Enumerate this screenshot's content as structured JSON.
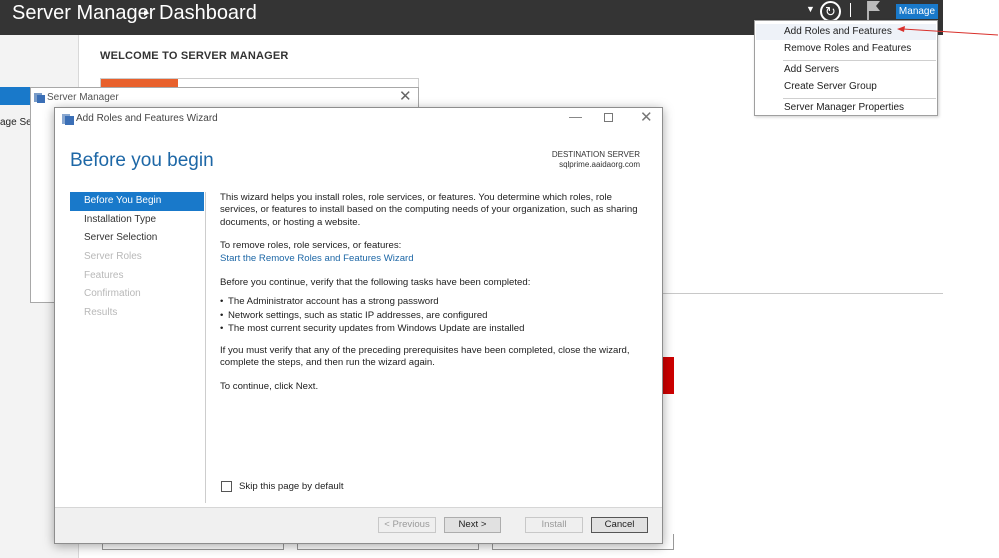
{
  "app": {
    "breadcrumb_root": "Server Manager",
    "breadcrumb_sep": "▸",
    "breadcrumb_page": "Dashboard",
    "manage_label": "Manage",
    "left_truncated_text": "age Se",
    "welcome_heading": "WELCOME TO SERVER MANAGER"
  },
  "behind_window": {
    "title": "Server Manager"
  },
  "wizard": {
    "title": "Add Roles and Features Wizard",
    "heading": "Before you begin",
    "destination_label": "DESTINATION SERVER",
    "destination_value": "sqlprime.aaidaorg.com",
    "nav": [
      {
        "label": "Before You Begin",
        "state": "active"
      },
      {
        "label": "Installation Type",
        "state": "enabled"
      },
      {
        "label": "Server Selection",
        "state": "enabled"
      },
      {
        "label": "Server Roles",
        "state": "disabled"
      },
      {
        "label": "Features",
        "state": "disabled"
      },
      {
        "label": "Confirmation",
        "state": "disabled"
      },
      {
        "label": "Results",
        "state": "disabled"
      }
    ],
    "intro": "This wizard helps you install roles, role services, or features. You determine which roles, role services, or features to install based on the computing needs of your organization, such as sharing documents, or hosting a website.",
    "remove_intro": "To remove roles, role services, or features:",
    "remove_link": "Start the Remove Roles and Features Wizard",
    "verify_intro": "Before you continue, verify that the following tasks have been completed:",
    "tasks": [
      "The Administrator account has a strong password",
      "Network settings, such as static IP addresses, are configured",
      "The most current security updates from Windows Update are installed"
    ],
    "prereq_text": "If you must verify that any of the preceding prerequisites have been completed, close the wizard, complete the steps, and then run the wizard again.",
    "continue_text": "To continue, click Next.",
    "skip_label": "Skip this page by default",
    "buttons": {
      "previous": "< Previous",
      "next": "Next >",
      "install": "Install",
      "cancel": "Cancel"
    }
  },
  "manage_menu": {
    "items": [
      "Add Roles and Features",
      "Remove Roles and Features",
      "Add Servers",
      "Create Server Group",
      "Server Manager Properties"
    ]
  },
  "colors": {
    "accent": "#1979ca",
    "titlebar": "#343434",
    "heading_blue": "#1d67a6",
    "orange_tile": "#e8602c",
    "red_tile": "#cd0000",
    "annotation": "#d9302b"
  }
}
